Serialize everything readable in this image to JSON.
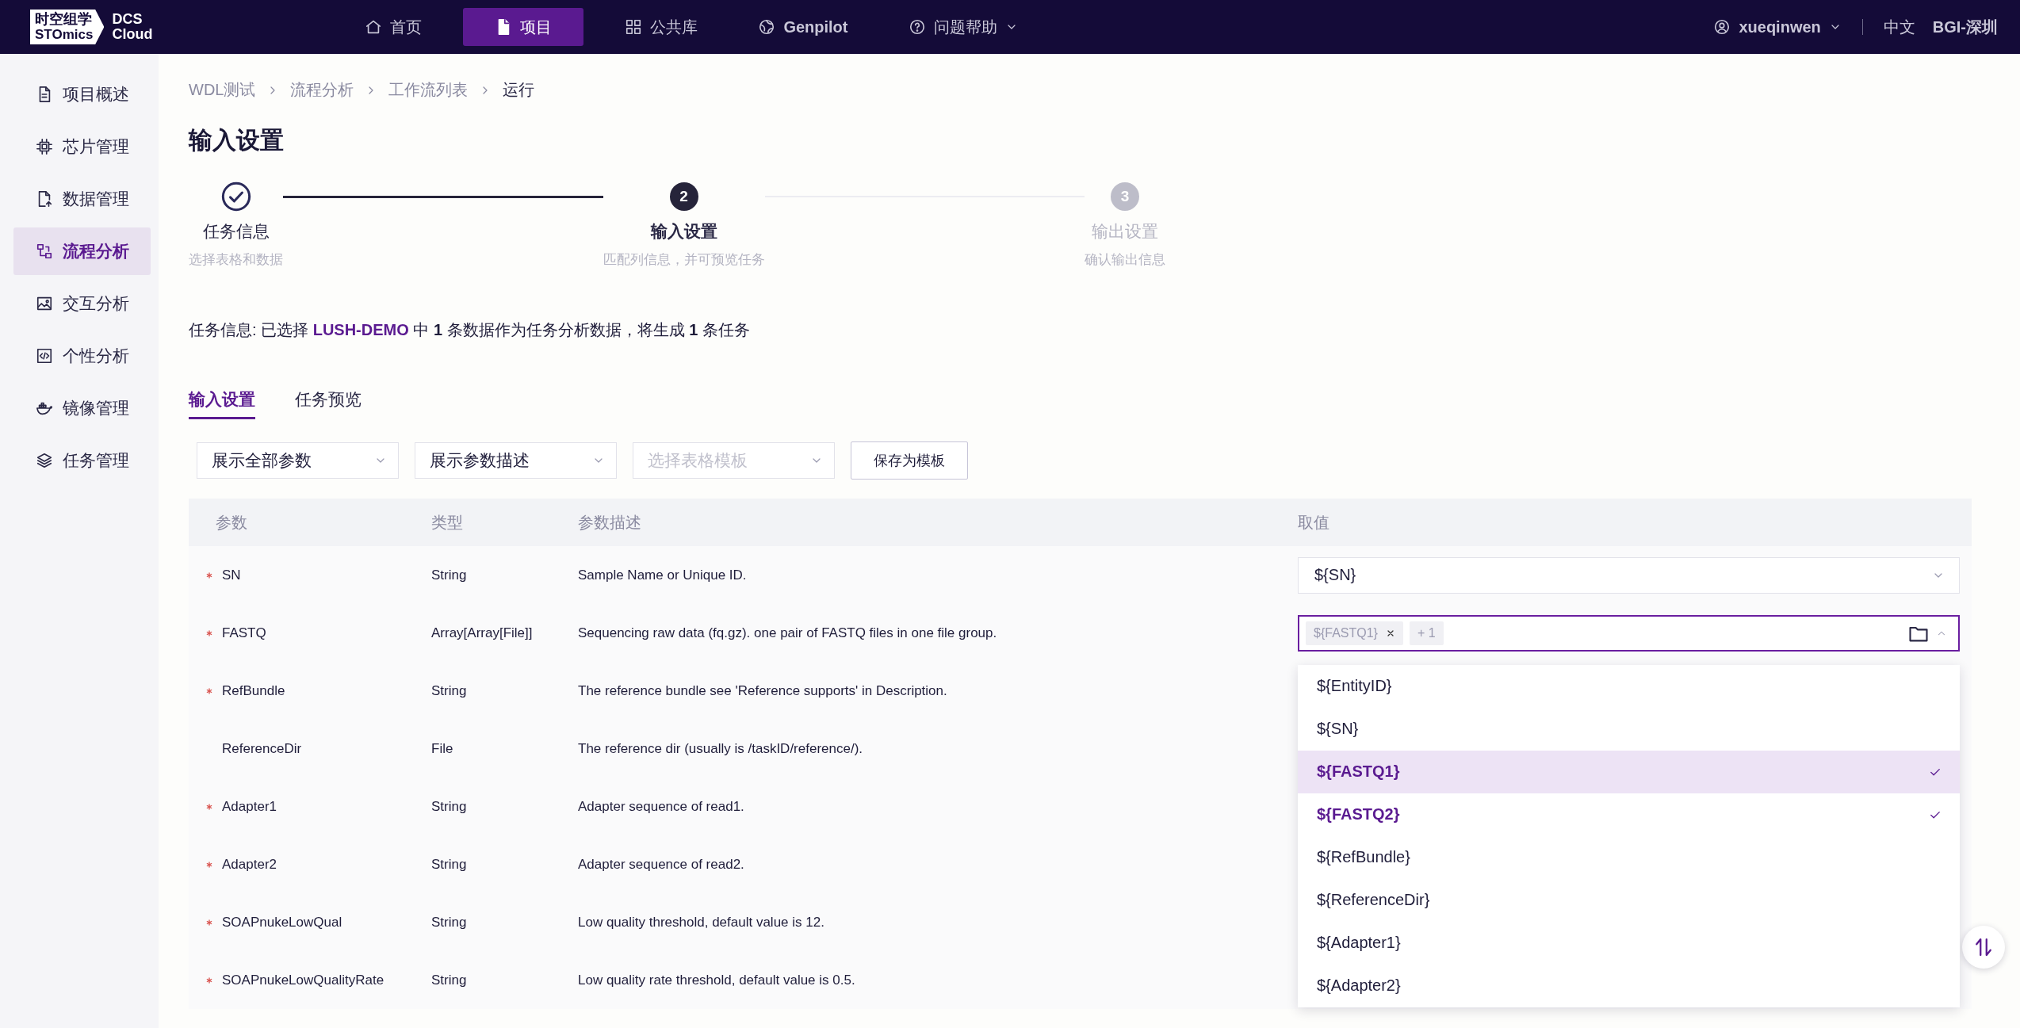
{
  "nav": {
    "logo": {
      "mark_top": "时空组学",
      "mark_bottom": "STOmics",
      "product_top": "DCS",
      "product_bottom": "Cloud"
    },
    "items": [
      {
        "label": "首页",
        "selected": false,
        "has_menu": false
      },
      {
        "label": "项目",
        "selected": true,
        "has_menu": false
      },
      {
        "label": "公共库",
        "selected": false,
        "has_menu": false
      },
      {
        "label": "Genpilot",
        "selected": false,
        "has_menu": false
      },
      {
        "label": "问题帮助",
        "selected": false,
        "has_menu": true
      }
    ],
    "user": "xueqinwen",
    "language": "中文",
    "region": "BGI-深圳"
  },
  "sidebar": {
    "items": [
      {
        "label": "项目概述",
        "selected": false
      },
      {
        "label": "芯片管理",
        "selected": false
      },
      {
        "label": "数据管理",
        "selected": false
      },
      {
        "label": "流程分析",
        "selected": true
      },
      {
        "label": "交互分析",
        "selected": false
      },
      {
        "label": "个性分析",
        "selected": false
      },
      {
        "label": "镜像管理",
        "selected": false
      },
      {
        "label": "任务管理",
        "selected": false
      }
    ]
  },
  "breadcrumb": [
    "WDL测试",
    "流程分析",
    "工作流列表",
    "运行"
  ],
  "page_title": "输入设置",
  "steps": [
    {
      "completed": true,
      "active": false,
      "title": "任务信息",
      "subtitle": "选择表格和数据"
    },
    {
      "completed": false,
      "active": true,
      "number": "2",
      "title": "输入设置",
      "subtitle": "匹配列信息，并可预览任务"
    },
    {
      "completed": false,
      "active": false,
      "number": "3",
      "title": "输出设置",
      "subtitle": "确认输出信息"
    }
  ],
  "info": [
    {
      "kind": "plain",
      "text": "任务信息: 已选择 "
    },
    {
      "kind": "highlight",
      "text": "LUSH-DEMO"
    },
    {
      "kind": "plain",
      "text": " 中 "
    },
    {
      "kind": "bold",
      "text": "1"
    },
    {
      "kind": "plain",
      "text": " 条数据作为任务分析数据，将生成 "
    },
    {
      "kind": "bold",
      "text": "1"
    },
    {
      "kind": "plain",
      "text": " 条任务"
    }
  ],
  "tabs": [
    {
      "label": "输入设置",
      "selected": true
    },
    {
      "label": "任务预览",
      "selected": false
    }
  ],
  "filters": [
    {
      "value": "展示全部参数"
    },
    {
      "value": "展示参数描述"
    },
    {
      "placeholder": "选择表格模板"
    }
  ],
  "save_button": "保存为模板",
  "table": {
    "columns": [
      "参数",
      "类型",
      "参数描述",
      "取值"
    ],
    "rows": [
      {
        "required": true,
        "name": "SN",
        "type": "String",
        "description": "Sample Name or Unique ID.",
        "value": {
          "kind": "select",
          "text": "${SN}"
        }
      },
      {
        "required": true,
        "name": "FASTQ",
        "type": "Array[Array[File]]",
        "description": "Sequencing raw data (fq.gz). one pair of FASTQ files in one file group.",
        "value": {
          "kind": "tags",
          "tags": [
            "${FASTQ1}"
          ],
          "more": "+ 1",
          "open": true
        }
      },
      {
        "required": true,
        "name": "RefBundle",
        "type": "String",
        "description": "The reference bundle see 'Reference supports' in Description."
      },
      {
        "required": false,
        "name": "ReferenceDir",
        "type": "File",
        "description": "The reference dir (usually is /taskID/reference/)."
      },
      {
        "required": true,
        "name": "Adapter1",
        "type": "String",
        "description": "Adapter sequence of read1."
      },
      {
        "required": true,
        "name": "Adapter2",
        "type": "String",
        "description": "Adapter sequence of read2."
      },
      {
        "required": true,
        "name": "SOAPnukeLowQual",
        "type": "String",
        "description": "Low quality threshold, default value is 12."
      },
      {
        "required": true,
        "name": "SOAPnukeLowQualityRate",
        "type": "String",
        "description": "Low quality rate threshold, default value is 0.5."
      }
    ]
  },
  "dropdown": {
    "options": [
      {
        "label": "${EntityID}",
        "selected": false,
        "highlighted": false
      },
      {
        "label": "${SN}",
        "selected": false,
        "highlighted": false
      },
      {
        "label": "${FASTQ1}",
        "selected": true,
        "highlighted": true
      },
      {
        "label": "${FASTQ2}",
        "selected": true,
        "highlighted": false
      },
      {
        "label": "${RefBundle}",
        "selected": false,
        "highlighted": false
      },
      {
        "label": "${ReferenceDir}",
        "selected": false,
        "highlighted": false
      },
      {
        "label": "${Adapter1}",
        "selected": false,
        "highlighted": false
      },
      {
        "label": "${Adapter2}",
        "selected": false,
        "highlighted": false
      }
    ]
  }
}
